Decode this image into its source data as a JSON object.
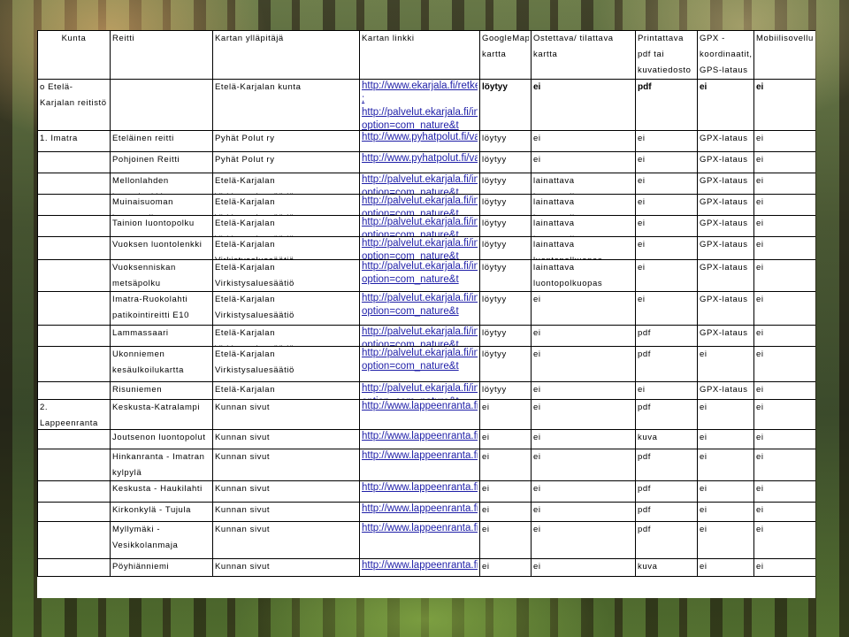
{
  "header": {
    "kunta": "Kunta",
    "reitti": "Reitti",
    "yllapitaja": "Kartan ylläpitäjä",
    "linkki": "Kartan linkki",
    "googlemaps": "GoogleMaps-kartta",
    "ostettava": "Ostettava/ tilattava kartta",
    "printattava": "Printattava pdf tai kuvatiedosto",
    "gpx": "GPX - koordinaatit, GPS-lataus",
    "mobiili": "Mobiilisovellus"
  },
  "rows": [
    {
      "kunta": "o Etelä-Karjalan reitistö",
      "reitti": "",
      "yllapitaja": "Etelä-Karjalan kunta",
      "linkki": "http://www.ekarjala.fi/retkeily/ ; http://palvelut.ekarjala.fi/index.php?option=com_nature&t",
      "google": "löytyy",
      "ostettava": "ei",
      "print": "pdf",
      "gpx": "ei",
      "mobiili": "ei"
    },
    {
      "kunta": "1. Imatra",
      "reitti": "Eteläinen reitti",
      "yllapitaja": "Pyhät Polut ry",
      "linkki": "http://www.pyhatpolut.fi/vaellukset/reitit",
      "google": "löytyy",
      "ostettava": "ei",
      "print": "ei",
      "gpx": "GPX-lataus",
      "mobiili": "ei"
    },
    {
      "kunta": "",
      "reitti": "Pohjoinen Reitti",
      "yllapitaja": "Pyhät Polut ry",
      "linkki": "http://www.pyhatpolut.fi/vaellukset/reitit",
      "google": "löytyy",
      "ostettava": "ei",
      "print": "ei",
      "gpx": "GPX-lataus",
      "mobiili": "ei"
    },
    {
      "kunta": "",
      "reitti": "Mellonlahden luontolenkki",
      "yllapitaja": "Etelä-Karjalan Virkistysaluesäätiö",
      "linkki": "http://palvelut.ekarjala.fi/index.php?option=com_nature&t",
      "google": "löytyy",
      "ostettava": "lainattava luontopolkuopas",
      "print": "ei",
      "gpx": "GPX-lataus",
      "mobiili": "ei"
    },
    {
      "kunta": "",
      "reitti": "Muinaisuoman luontopolku",
      "yllapitaja": "Etelä-Karjalan Virkistysaluesäätiö",
      "linkki": "http://palvelut.ekarjala.fi/index.php?option=com_nature&t",
      "google": "löytyy",
      "ostettava": "lainattava luontopolkuopas",
      "print": "ei",
      "gpx": "GPX-lataus",
      "mobiili": "ei"
    },
    {
      "kunta": "",
      "reitti": "Tainion luontopolku",
      "yllapitaja": "Etelä-Karjalan Virkistysaluesäätiö",
      "linkki": "http://palvelut.ekarjala.fi/index.php?option=com_nature&t",
      "google": "löytyy",
      "ostettava": "lainattava luontopolkuopas",
      "print": "ei",
      "gpx": "GPX-lataus",
      "mobiili": "ei"
    },
    {
      "kunta": "",
      "reitti": "Vuoksen luontolenkki",
      "yllapitaja": "Etelä-Karjalan Virkistysaluesäätiö",
      "linkki": "http://palvelut.ekarjala.fi/index.php?option=com_nature&t",
      "google": "löytyy",
      "ostettava": "lainattava luontopolkuopas",
      "print": "ei",
      "gpx": "GPX-lataus",
      "mobiili": "ei"
    },
    {
      "kunta": "",
      "reitti": "Vuoksenniskan metsäpolku",
      "yllapitaja": "Etelä-Karjalan Virkistysaluesäätiö",
      "linkki": "http://palvelut.ekarjala.fi/index.php?option=com_nature&t",
      "google": "löytyy",
      "ostettava": "lainattava luontopolkuopas",
      "print": "ei",
      "gpx": "GPX-lataus",
      "mobiili": "ei"
    },
    {
      "kunta": "",
      "reitti": "Imatra-Ruokolahti patikointireitti E10",
      "yllapitaja": "Etelä-Karjalan Virkistysaluesäätiö",
      "linkki": "http://palvelut.ekarjala.fi/index.php?option=com_nature&t",
      "google": "löytyy",
      "ostettava": "ei",
      "print": "ei",
      "gpx": "GPX-lataus",
      "mobiili": "ei"
    },
    {
      "kunta": "",
      "reitti": "Lammassaari",
      "yllapitaja": "Etelä-Karjalan Virkistysaluesäätiö",
      "linkki": "http://palvelut.ekarjala.fi/index.php?option=com_nature&t",
      "google": "löytyy",
      "ostettava": "ei",
      "print": "pdf",
      "gpx": "GPX-lataus",
      "mobiili": "ei"
    },
    {
      "kunta": "",
      "reitti": "Ukonniemen kesäulkoilukartta",
      "yllapitaja": "Etelä-Karjalan Virkistysaluesäätiö",
      "linkki": "http://palvelut.ekarjala.fi/index.php?option=com_nature&t",
      "google": "löytyy",
      "ostettava": "ei",
      "print": "pdf",
      "gpx": "ei",
      "mobiili": "ei"
    },
    {
      "kunta": "",
      "reitti": "Risuniemen luontopolku",
      "yllapitaja": "Etelä-Karjalan Virkistysaluesäätiö",
      "linkki": "http://palvelut.ekarjala.fi/index.php?option=com_nature&t",
      "google": "löytyy",
      "ostettava": "ei",
      "print": "ei",
      "gpx": "GPX-lataus",
      "mobiili": "ei"
    },
    {
      "kunta": "2. Lappeenranta",
      "reitti": "Keskusta-Katralampi",
      "yllapitaja": "Kunnan sivut",
      "linkki": "http://www.lappeenranta.fi/Suomeksi/Palvelut/Liikunta_ja",
      "google": "ei",
      "ostettava": "ei",
      "print": "pdf",
      "gpx": "ei",
      "mobiili": "ei"
    },
    {
      "kunta": "",
      "reitti": "Joutsenon luontopolut",
      "yllapitaja": "Kunnan sivut",
      "linkki": "http://www.lappeenranta.fi/lo",
      "google": "ei",
      "ostettava": "ei",
      "print": "kuva",
      "gpx": "ei",
      "mobiili": "ei"
    },
    {
      "kunta": "",
      "reitti": "Hinkanranta - Imatran kylpylä",
      "yllapitaja": "Kunnan sivut",
      "linkki": "http://www.lappeenranta.fi/Suomeksi/Palvelut/Liikunta_ja",
      "google": "ei",
      "ostettava": "ei",
      "print": "pdf",
      "gpx": "ei",
      "mobiili": "ei"
    },
    {
      "kunta": "",
      "reitti": "Keskusta - Haukilahti",
      "yllapitaja": "Kunnan sivut",
      "linkki": "http://www.lappeenranta.fi/Suomeksi/Palvelut/Liikunta_ja",
      "google": "ei",
      "ostettava": "ei",
      "print": "pdf",
      "gpx": "ei",
      "mobiili": "ei"
    },
    {
      "kunta": "",
      "reitti": "Kirkonkylä - Tujula",
      "yllapitaja": "Kunnan sivut",
      "linkki": "http://www.lappeenranta.fi/Suomeksi/Palvelut/Liikunta_ja",
      "google": "ei",
      "ostettava": "ei",
      "print": "pdf",
      "gpx": "ei",
      "mobiili": "ei"
    },
    {
      "kunta": "",
      "reitti": "Myllymäki - Vesikkolanmaja",
      "yllapitaja": "Kunnan sivut",
      "linkki": "http://www.lappeenranta.fi/Suomeksi/Palvelut/Liikunta_ja",
      "google": "ei",
      "ostettava": "ei",
      "print": "pdf",
      "gpx": "ei",
      "mobiili": "ei"
    },
    {
      "kunta": "",
      "reitti": "Pöyhiänniemi",
      "yllapitaja": "Kunnan sivut",
      "linkki": "http://www.lappeenranta.fi/lo",
      "google": "ei",
      "ostettava": "ei",
      "print": "kuva",
      "gpx": "ei",
      "mobiili": "ei"
    }
  ]
}
